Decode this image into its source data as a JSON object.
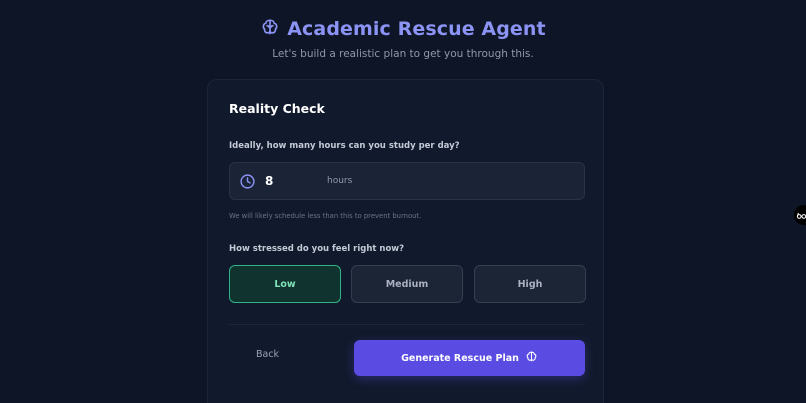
{
  "header": {
    "title": "Academic Rescue Agent",
    "subtitle": "Let's build a realistic plan to get you through this.",
    "icon": "brain-icon"
  },
  "card": {
    "title": "Reality Check",
    "hours": {
      "label": "Ideally, how many hours can you study per day?",
      "value": "8",
      "unit": "hours",
      "icon": "clock-icon",
      "hint": "We will likely schedule less than this to prevent burnout."
    },
    "stress": {
      "label": "How stressed do you feel right now?",
      "options": [
        "Low",
        "Medium",
        "High"
      ],
      "selected": "Low"
    },
    "actions": {
      "back_label": "Back",
      "generate_label": "Generate Rescue Plan"
    }
  },
  "colors": {
    "background": "#0e1526",
    "accent": "#8b93f4",
    "primary_button": "#5a4be3",
    "selected_green": "#2fb486"
  }
}
